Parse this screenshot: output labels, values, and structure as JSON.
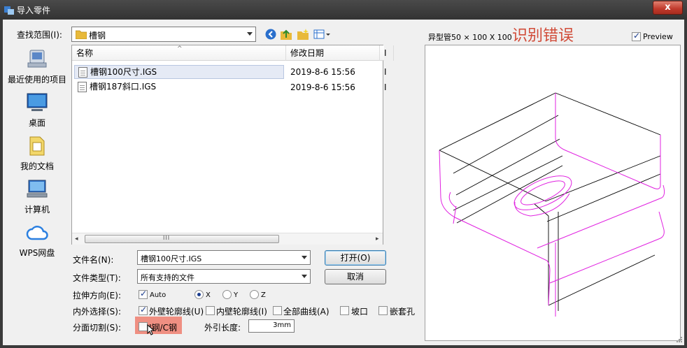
{
  "window": {
    "title": "导入零件",
    "close_label": "x"
  },
  "look_in": {
    "label": "查找范围(I):",
    "value": "槽钢"
  },
  "toolbar": {
    "icons": [
      "back-icon",
      "up-folder-icon",
      "new-folder-icon",
      "view-menu-icon"
    ]
  },
  "places": [
    {
      "label": "最近使用的项目",
      "icon": "recent-items-icon"
    },
    {
      "label": "桌面",
      "icon": "desktop-icon"
    },
    {
      "label": "我的文档",
      "icon": "documents-icon"
    },
    {
      "label": "计算机",
      "icon": "computer-icon"
    },
    {
      "label": "WPS网盘",
      "icon": "cloud-icon"
    }
  ],
  "file_list": {
    "columns": [
      "名称",
      "修改日期",
      "I"
    ],
    "rows": [
      {
        "name": "槽钢100尺寸.IGS",
        "date": "2019-8-6 15:56",
        "type": "I",
        "selected": true
      },
      {
        "name": "槽钢187斜口.IGS",
        "date": "2019-8-6 15:56",
        "type": "I",
        "selected": false
      }
    ],
    "scroll_grip": "III"
  },
  "form": {
    "filename_label": "文件名(N):",
    "filename_value": "槽钢100尺寸.IGS",
    "filetype_label": "文件类型(T):",
    "filetype_value": "所有支持的文件",
    "open_label": "打开(O)",
    "cancel_label": "取消",
    "stretch_label": "拉伸方向(E):",
    "auto_label": "Auto",
    "auto_checked": true,
    "x_label": "X",
    "y_label": "Y",
    "z_label": "Z",
    "stretch_selected": "X",
    "inout_label": "内外选择(S):",
    "outer_label": "外壁轮廓线(U)",
    "outer_checked": true,
    "inner_label": "内壁轮廓线(I)",
    "inner_checked": false,
    "allcurves_label": "全部曲线(A)",
    "allcurves_checked": false,
    "groove_label": "坡口",
    "groove_checked": false,
    "sleeve_label": "嵌套孔",
    "sleeve_checked": false,
    "split_label": "分面切割(S):",
    "split_option_label": "I钢/C钢",
    "split_checked": false,
    "extlen_label": "外引长度:",
    "extlen_value": "3mm"
  },
  "preview": {
    "caption": "异型管50 × 100 X 100",
    "annotation": "识别错误",
    "preview_label": "Preview",
    "preview_checked": true
  },
  "colors": {
    "highlight": "#ef8f82",
    "annotation": "#d14b38",
    "profile": "#e020e0"
  }
}
